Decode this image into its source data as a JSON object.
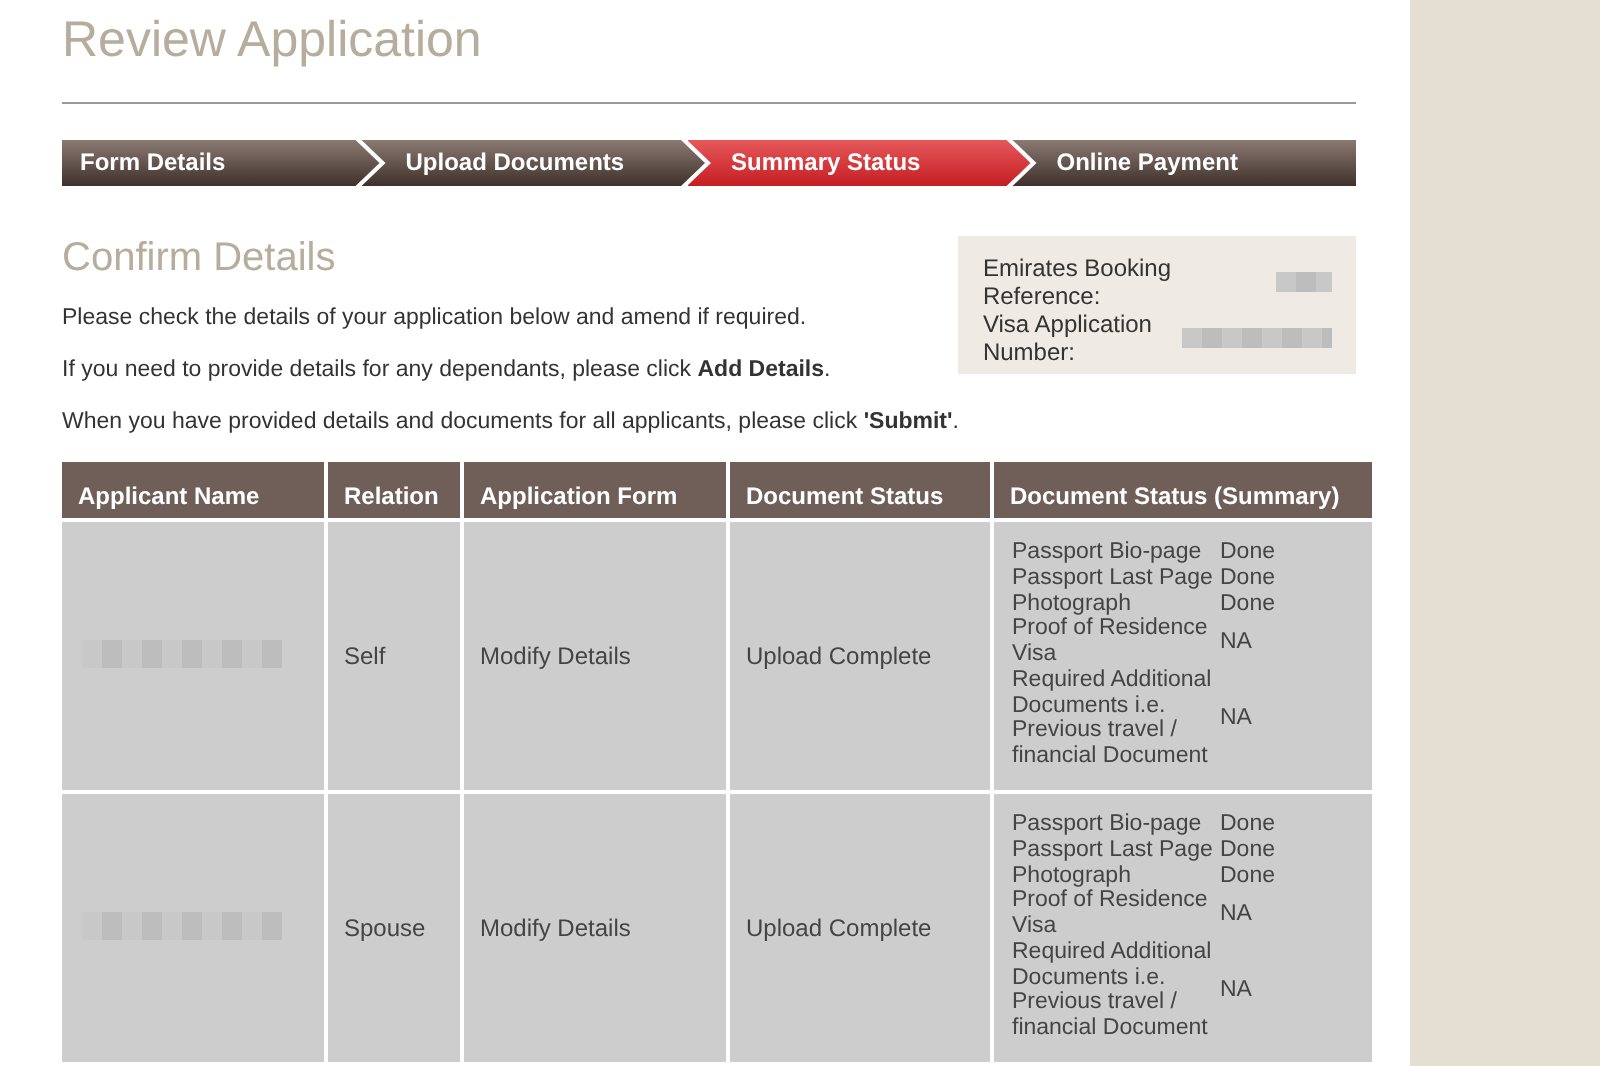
{
  "page_title": "Review Application",
  "steps": [
    {
      "label": "Form Details",
      "selected": false
    },
    {
      "label": "Upload Documents",
      "selected": false
    },
    {
      "label": "Summary Status",
      "selected": true
    },
    {
      "label": "Online Payment",
      "selected": false
    }
  ],
  "section_title": "Confirm Details",
  "instructions": [
    "Please check the details of your application below and amend if required.",
    "If you need to provide details for any dependants, please click **Add Details**.",
    "When you have provided details and documents for all applicants, please click **'Submit'**."
  ],
  "reference_box": {
    "fields": [
      {
        "label": "Emirates Booking Reference:"
      },
      {
        "label": "Visa Application Number:"
      }
    ]
  },
  "table": {
    "columns": [
      "Applicant Name",
      "Relation",
      "Application Form",
      "Document Status",
      "Document Status (Summary)"
    ],
    "rows": [
      {
        "relation": "Self",
        "application_form": "Modify Details",
        "document_status": "Upload Complete",
        "documents": [
          {
            "name": "Passport Bio-page",
            "status": "Done"
          },
          {
            "name": "Passport Last Page",
            "status": "Done"
          },
          {
            "name": "Photograph",
            "status": "Done"
          },
          {
            "name": "Proof of Residence Visa",
            "status": "NA"
          },
          {
            "name": "Required Additional Documents i.e. Previous travel / financial Document",
            "status": "NA"
          }
        ]
      },
      {
        "relation": "Spouse",
        "application_form": "Modify Details",
        "document_status": "Upload Complete",
        "documents": [
          {
            "name": "Passport Bio-page",
            "status": "Done"
          },
          {
            "name": "Passport Last Page",
            "status": "Done"
          },
          {
            "name": "Photograph",
            "status": "Done"
          },
          {
            "name": "Proof of Residence Visa",
            "status": "NA"
          },
          {
            "name": "Required Additional Documents i.e. Previous travel / financial Document",
            "status": "NA"
          }
        ]
      }
    ]
  }
}
